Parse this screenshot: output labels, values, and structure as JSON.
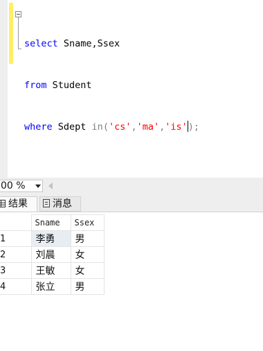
{
  "editor": {
    "lines": [
      {
        "tokens": [
          {
            "text": "select",
            "kind": "kw"
          },
          {
            "text": " Sname,Ssex",
            "kind": "plain"
          }
        ]
      },
      {
        "tokens": [
          {
            "text": "from",
            "kind": "kw"
          },
          {
            "text": " Student",
            "kind": "plain"
          }
        ]
      },
      {
        "tokens": [
          {
            "text": "where",
            "kind": "kw"
          },
          {
            "text": " Sdept ",
            "kind": "plain"
          },
          {
            "text": "in",
            "kind": "fn"
          },
          {
            "text": "(",
            "kind": "op"
          },
          {
            "text": "'cs'",
            "kind": "str"
          },
          {
            "text": ",",
            "kind": "op"
          },
          {
            "text": "'ma'",
            "kind": "str"
          },
          {
            "text": ",",
            "kind": "op"
          },
          {
            "text": "'is'",
            "kind": "str"
          },
          {
            "text": ");",
            "kind": "op"
          }
        ]
      }
    ]
  },
  "zoom": {
    "value": "00 %"
  },
  "tabs": {
    "results_label": "结果",
    "messages_label": "消息"
  },
  "results": {
    "columns": [
      "Sname",
      "Ssex"
    ],
    "rows": [
      {
        "num": "1",
        "cells": [
          "李勇",
          "男"
        ]
      },
      {
        "num": "2",
        "cells": [
          "刘晨",
          "女"
        ]
      },
      {
        "num": "3",
        "cells": [
          "王敏",
          "女"
        ]
      },
      {
        "num": "4",
        "cells": [
          "张立",
          "男"
        ]
      }
    ]
  },
  "colors": {
    "keyword": "#0000ff",
    "string": "#ff0000",
    "operator": "#808080",
    "change_bar": "#ffee63",
    "selected_cell": "#e7edf3"
  },
  "icons": {
    "results_tab": "grid-icon",
    "messages_tab": "message-icon",
    "zoom_dropdown": "chevron-down-icon",
    "scroll_left": "scroll-left-arrow-icon",
    "fold": "collapse-minus-icon"
  }
}
